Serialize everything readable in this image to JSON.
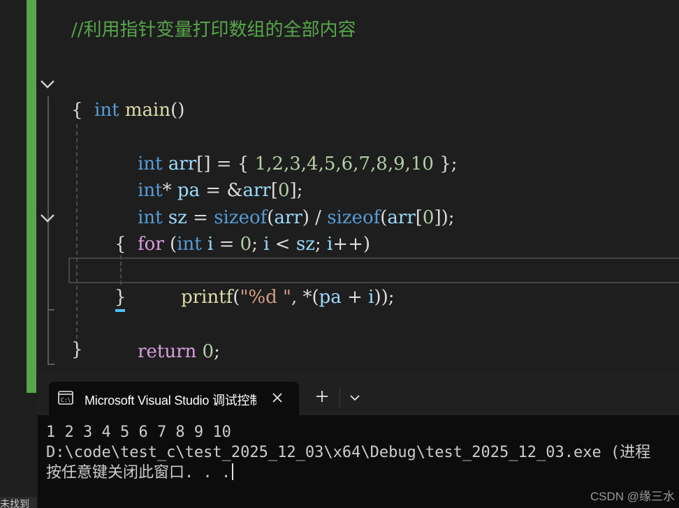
{
  "editor": {
    "comment": "//利用指针变量打印数组的全部内容",
    "line_main": {
      "kw": "int",
      "fn": "main",
      "rest": "()"
    },
    "open_brace": "{",
    "line_arr": {
      "kw": "int",
      "var": "arr",
      "p1": "[] = { ",
      "nums": "1,2,3,4,5,6,7,8,9,10",
      "p2": " };"
    },
    "line_pa": {
      "kw": "int",
      "p1": "* ",
      "var": "pa",
      "p2": " = &",
      "var2": "arr",
      "p3": "[",
      "num": "0",
      "p4": "];"
    },
    "line_sz": {
      "kw": "int",
      "var": "sz",
      "p1": " = ",
      "fn": "sizeof",
      "p2": "(",
      "var2": "arr",
      "p3": ") / ",
      "fn2": "sizeof",
      "p4": "(",
      "var3": "arr",
      "p5": "[",
      "num": "0",
      "p6": "]);"
    },
    "line_for": {
      "ctl": "for",
      "p1": " (",
      "kw": "int",
      "var": "i",
      "p2": " = ",
      "num": "0",
      "p3": "; ",
      "var2": "i",
      "p4": " < ",
      "var3": "sz",
      "p5": "; ",
      "var4": "i",
      "p6": "++)"
    },
    "inner_open": "{",
    "line_printf": {
      "fn": "printf",
      "p1": "(",
      "str": "\"%d \"",
      "p2": ", *(",
      "var": "pa",
      "p3": " + ",
      "var2": "i",
      "p4": "));"
    },
    "inner_close": "}",
    "line_return": {
      "ctl": "return",
      "num": "0",
      "p1": ";"
    },
    "close_brace": "}"
  },
  "terminal": {
    "tab_title": "Microsoft Visual Studio 调试控制台",
    "add_tab": "+",
    "output": [
      "1 2 3 4 5 6 7 8 9 10",
      "D:\\code\\test_c\\test_2025_12_03\\x64\\Debug\\test_2025_12_03.exe (进程",
      "按任意键关闭此窗口. . ."
    ]
  },
  "watermark": "CSDN @缘三水",
  "left_partial": "未找到"
}
